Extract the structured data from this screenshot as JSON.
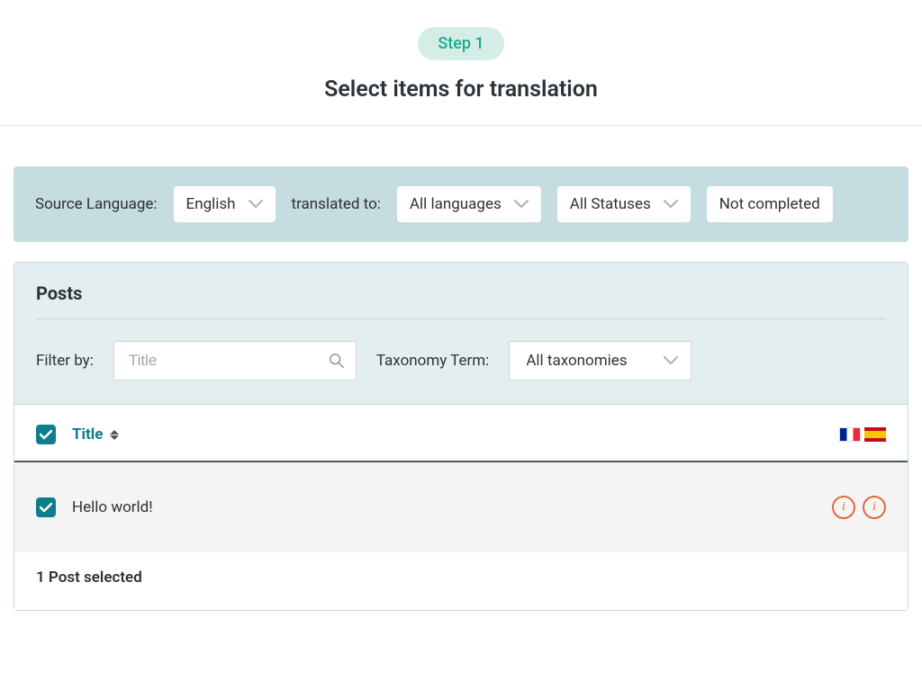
{
  "header": {
    "step_label": "Step 1",
    "title": "Select items for translation"
  },
  "filters": {
    "source_label": "Source Language:",
    "source_value": "English",
    "translated_label": "translated to:",
    "translated_value": "All languages",
    "status_value": "All Statuses",
    "completion_value": "Not completed"
  },
  "posts": {
    "heading": "Posts",
    "filter_label": "Filter by:",
    "search_placeholder": "Title",
    "taxonomy_label": "Taxonomy Term:",
    "taxonomy_value": "All taxonomies",
    "columns": {
      "title": "Title"
    },
    "flags": [
      "fr",
      "es"
    ],
    "rows": [
      {
        "title": "Hello world!",
        "checked": true,
        "statuses": [
          "info",
          "info"
        ]
      }
    ],
    "footer": "1 Post selected"
  },
  "icons": {
    "info_glyph": "i"
  }
}
